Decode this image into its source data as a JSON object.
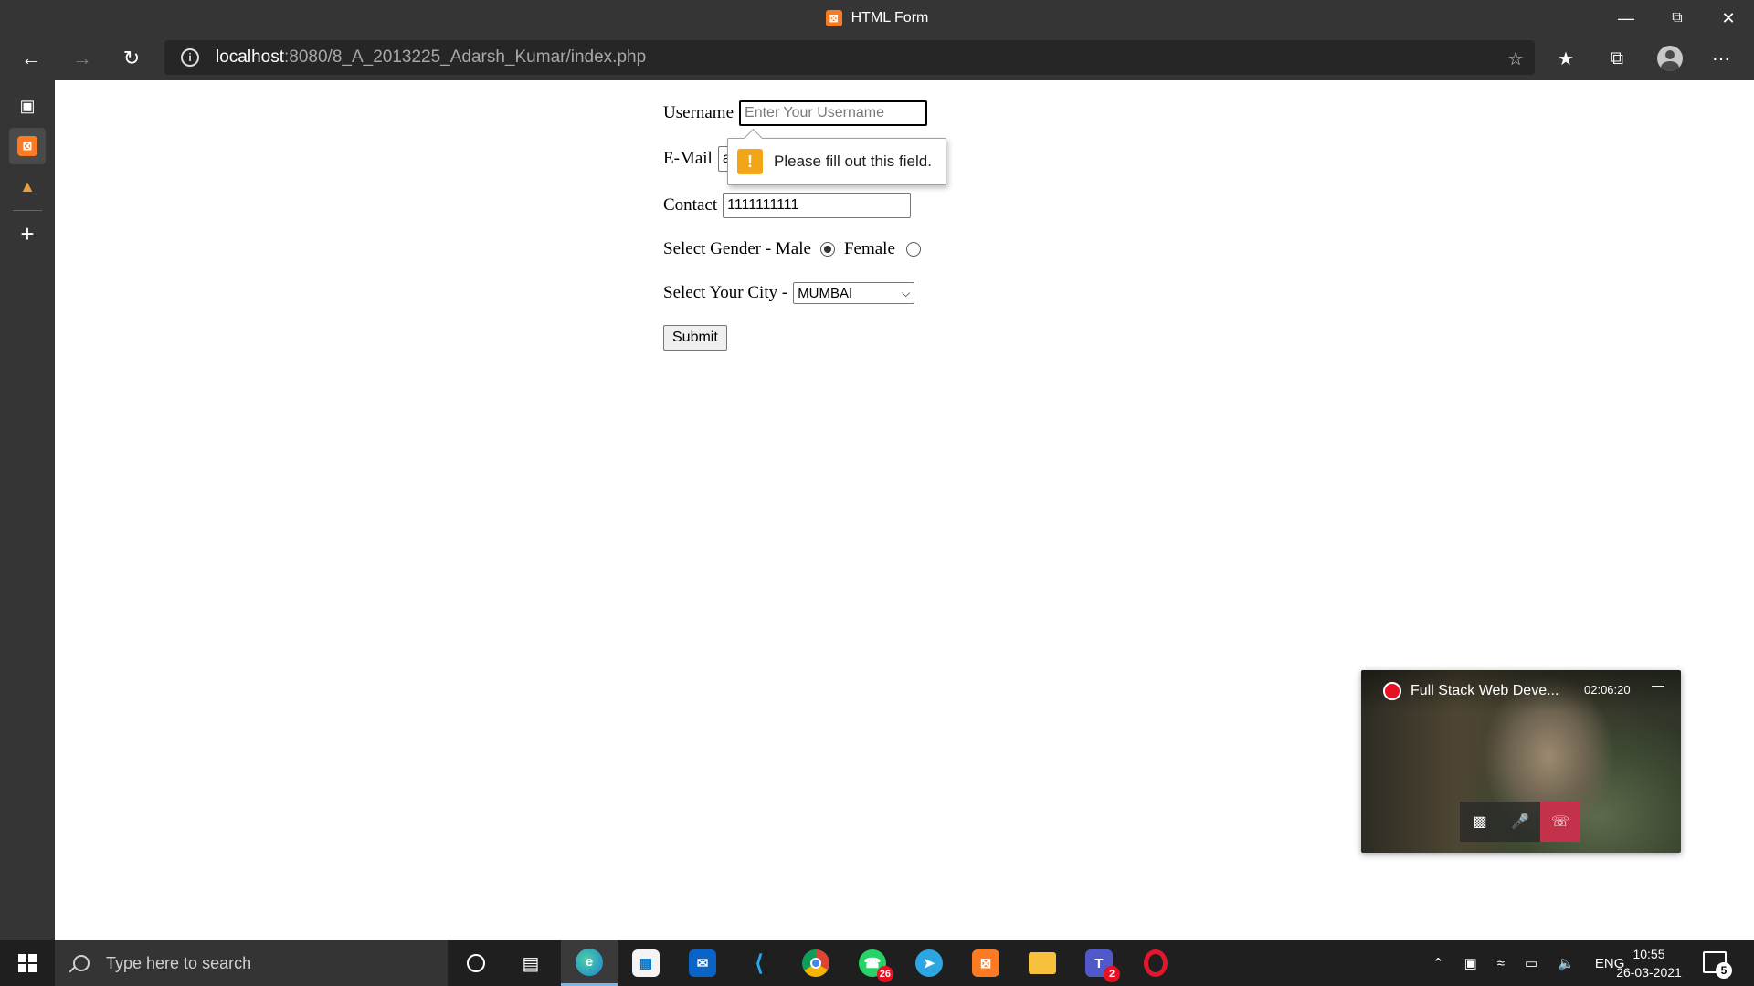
{
  "window": {
    "title": "HTML Form",
    "minimize_icon": "minimize-icon",
    "restore_icon": "restore-icon",
    "close_icon": "close-icon"
  },
  "nav": {
    "url_host": "localhost",
    "url_path": ":8080/8_A_2013225_Adarsh_Kumar/index.php"
  },
  "form": {
    "username_label": "Username",
    "username_placeholder": "Enter Your Username",
    "email_label": "E-Mail",
    "email_value": "a",
    "contact_label": "Contact",
    "contact_value": "1111111111",
    "gender_label": "Select Gender - Male",
    "gender_options": [
      "Male",
      "Female"
    ],
    "gender_selected": "Male",
    "female_label": "Female",
    "city_label": "Select Your City -",
    "city_selected": "MUMBAI",
    "submit_label": "Submit"
  },
  "validation": {
    "message": "Please fill out this field.",
    "warn_glyph": "!"
  },
  "call": {
    "title": "Full Stack Web Deve...",
    "duration": "02:06:20"
  },
  "taskbar": {
    "search_placeholder": "Type here to search",
    "whatsapp_badge": "26",
    "teams_badge": "2",
    "language": "ENG",
    "time": "10:55",
    "date": "26-03-2021",
    "notification_count": "5"
  },
  "colors": {
    "chrome_bg": "#353535",
    "taskbar_bg": "#1f1f1f",
    "xampp": "#fb7a24",
    "warn": "#f3a51a",
    "hangup": "#c4314b",
    "edge_active_underline": "#76b9ed"
  }
}
